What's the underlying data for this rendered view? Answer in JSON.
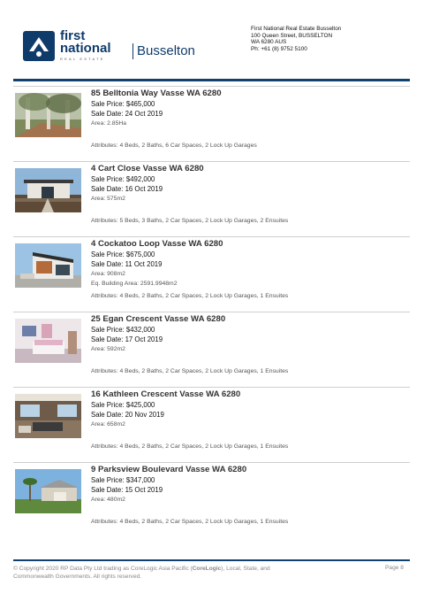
{
  "header": {
    "logo": {
      "line1": "first",
      "line2": "national",
      "tagline": "REAL ESTATE",
      "branch": "Busselton"
    },
    "agency": {
      "name": "First National Real Estate Busselton",
      "street": "100 Queen Street, BUSSELTON",
      "region": "WA 6280 AUS",
      "phone": "Ph: +61 (8) 9752 5100"
    },
    "colors": {
      "brand_navy": "#11416e"
    }
  },
  "listings": [
    {
      "address": "85 Belltonia Way Vasse WA 6280",
      "price": "Sale Price: $465,000",
      "date": "Sale Date: 24 Oct 2019",
      "area": "Area: 2.85Ha",
      "extra": "",
      "attributes": "Attributes: 4 Beds, 2 Baths, 6 Car Spaces, 2 Lock Up Garages"
    },
    {
      "address": "4 Cart Close Vasse WA 6280",
      "price": "Sale Price: $492,000",
      "date": "Sale Date: 16 Oct 2019",
      "area": "Area: 575m2",
      "extra": "",
      "attributes": "Attributes: 5 Beds, 3 Baths, 2 Car Spaces, 2 Lock Up Garages, 2 Ensuites"
    },
    {
      "address": "4 Cockatoo Loop Vasse WA 6280",
      "price": "Sale Price: $675,000",
      "date": "Sale Date: 11 Oct 2019",
      "area": "Area: 908m2",
      "extra": "Eq. Building Area: 2591.9948m2",
      "attributes": "Attributes: 4 Beds, 2 Baths, 2 Car Spaces, 2 Lock Up Garages, 1 Ensuites"
    },
    {
      "address": "25 Egan Crescent Vasse WA 6280",
      "price": "Sale Price: $432,000",
      "date": "Sale Date: 17 Oct 2019",
      "area": "Area: 592m2",
      "extra": "",
      "attributes": "Attributes: 4 Beds, 2 Baths, 2 Car Spaces, 2 Lock Up Garages, 1 Ensuites"
    },
    {
      "address": "16 Kathleen Crescent Vasse WA 6280",
      "price": "Sale Price: $425,000",
      "date": "Sale Date: 20 Nov 2019",
      "area": "Area: 658m2",
      "extra": "",
      "attributes": "Attributes: 4 Beds, 2 Baths, 2 Car Spaces, 2 Lock Up Garages, 1 Ensuites"
    },
    {
      "address": "9 Parksview Boulevard Vasse WA 6280",
      "price": "Sale Price: $347,000",
      "date": "Sale Date: 15 Oct 2019",
      "area": "Area: 480m2",
      "extra": "",
      "attributes": "Attributes: 4 Beds, 2 Baths, 2 Car Spaces, 2 Lock Up Garages, 1 Ensuites"
    }
  ],
  "footer": {
    "copyright_pre": "© Copyright 2020 RP Data Pty Ltd trading as CoreLogic Asia Pacific (",
    "copyright_bold": "CoreLogic",
    "copyright_post": "), Local, State, and",
    "copyright_line2": "Commonwealth Governments.  All rights reserved.",
    "page": "Page 8"
  }
}
